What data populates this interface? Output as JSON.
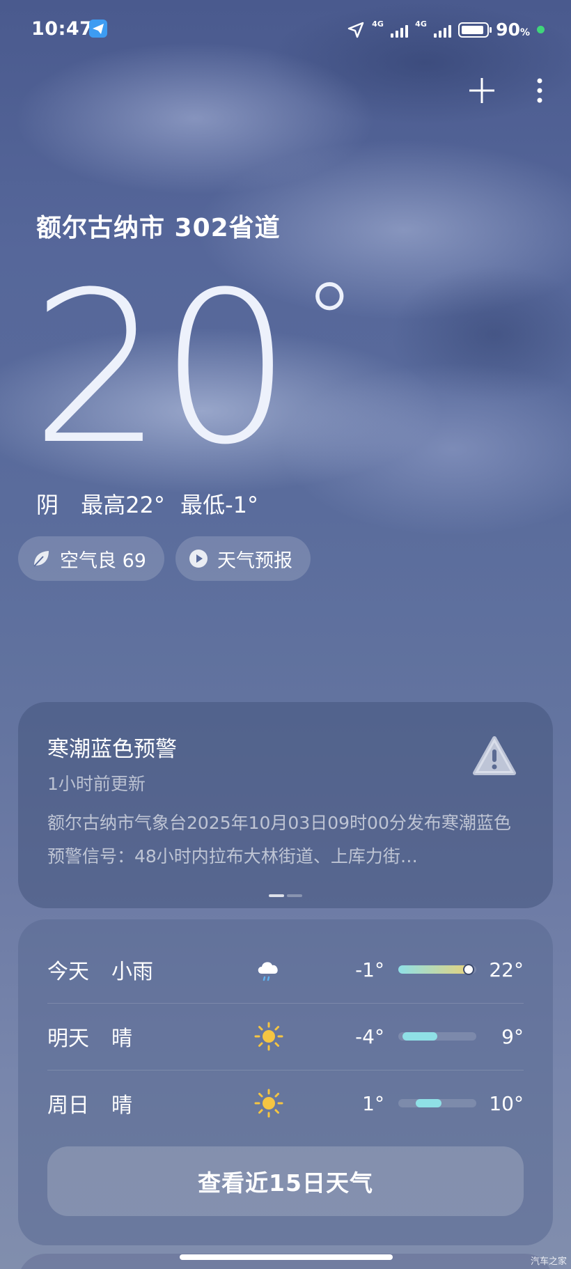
{
  "status_bar": {
    "time": "10:47",
    "network_1": "4G",
    "network_2": "4G",
    "battery_percent": "90",
    "battery_unit": "%"
  },
  "header": {
    "location": "额尔古纳市 302省道"
  },
  "current": {
    "temperature": "20",
    "degree_symbol": "°",
    "condition": "阴",
    "high": "最高22°",
    "low": "最低-1°"
  },
  "chips": {
    "air_quality": "空气良 69",
    "forecast_video": "天气预报"
  },
  "alert": {
    "title": "寒潮蓝色预警",
    "updated": "1小时前更新",
    "body": "额尔古纳市气象台2025年10月03日09时00分发布寒潮蓝色预警信号：48小时内拉布大林街道、上库力街…"
  },
  "forecast": {
    "days": [
      {
        "day": "今天",
        "condition": "小雨",
        "icon": "cloud-rain-icon",
        "low": "-1°",
        "high": "22°",
        "range_start": 0.0,
        "range_end": 0.95,
        "current_marker": 0.9
      },
      {
        "day": "明天",
        "condition": "晴",
        "icon": "sun-icon",
        "low": "-4°",
        "high": "9°",
        "range_start": 0.05,
        "range_end": 0.5
      },
      {
        "day": "周日",
        "condition": "晴",
        "icon": "sun-icon",
        "low": "1°",
        "high": "10°",
        "range_start": 0.22,
        "range_end": 0.55
      }
    ],
    "more_button": "查看近15日天气"
  },
  "watermark": "汽车之家",
  "colors": {
    "accent_green": "#3fd67a",
    "sun_yellow": "#f5c542",
    "range_cool": "#8fe0e6",
    "range_warm": "#e8d27a"
  }
}
